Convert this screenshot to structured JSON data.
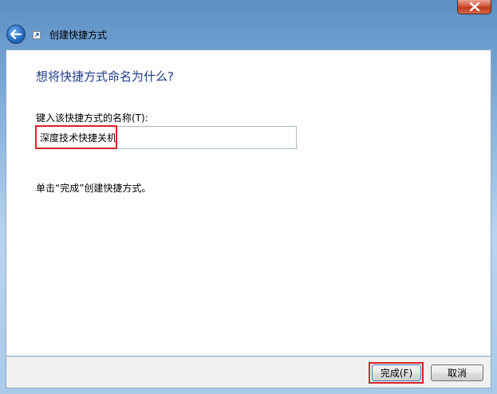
{
  "window": {
    "title": "创建快捷方式",
    "close_icon": "close-icon",
    "back_icon": "back-arrow-icon"
  },
  "main": {
    "heading": "想将快捷方式命名为什么?",
    "field_label": "键入该快捷方式的名称(T):",
    "name_value": "深度技术快捷关机",
    "info": "单击“完成”创建快捷方式。"
  },
  "buttons": {
    "finish": "完成(F)",
    "cancel": "取消"
  },
  "colors": {
    "highlight": "#d8232a",
    "heading": "#1e3a8a"
  }
}
